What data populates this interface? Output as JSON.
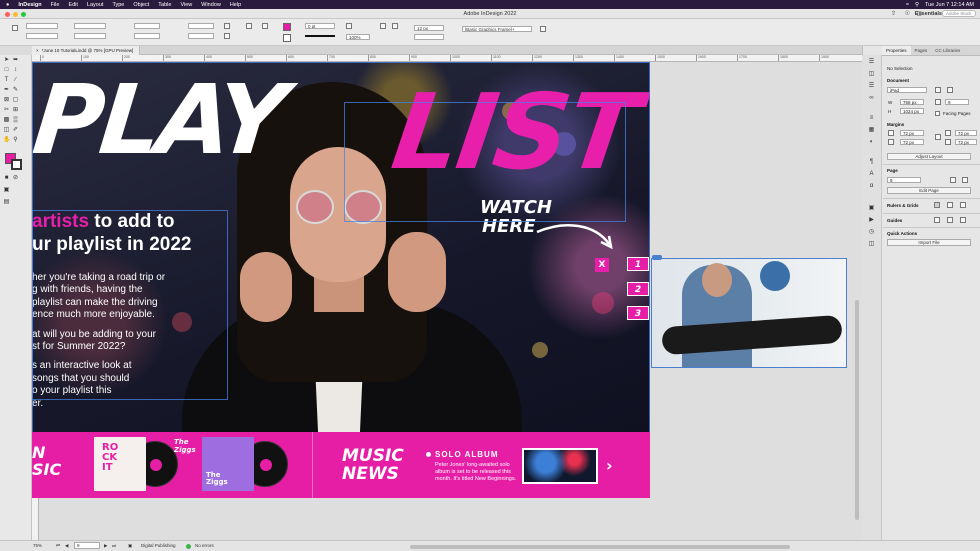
{
  "os_menubar": {
    "app_name": "InDesign",
    "menus": [
      "File",
      "Edit",
      "Layout",
      "Type",
      "Object",
      "Table",
      "View",
      "Window",
      "Help"
    ],
    "clock": "Tue Jun 7  12:14 AM"
  },
  "window": {
    "title": "Adobe InDesign 2022",
    "workspace": "Essentials",
    "search_placeholder": "Adobe Stock"
  },
  "control_bar": {
    "stroke_weight": "0 pt",
    "percent_value": "100%",
    "font_size_value": "12 px",
    "frame_style": "[Basic Graphics Frame]+"
  },
  "document_tab": {
    "label": "*June 10 TutorialLindd @ 75% [GPU Preview]"
  },
  "ruler_ticks": [
    "0",
    "100",
    "200",
    "300",
    "400",
    "500",
    "600",
    "700",
    "800",
    "900",
    "1000",
    "1100",
    "1200",
    "1300",
    "1400",
    "1500",
    "1600",
    "1700",
    "1800",
    "1900"
  ],
  "artwork": {
    "headline_left": "PLAY",
    "headline_right": "LIST",
    "subhead_pink": "artists",
    "subhead_rest_1": " to add to",
    "subhead_line2": "ur playlist in 2022",
    "body_lines": [
      [
        "her you're taking a road trip or",
        "g with friends, having the",
        "playlist can make the driving",
        "ence much more enjoyable."
      ],
      [
        "at will you be adding to your",
        "st for Summer 2022?"
      ],
      [
        "s an interactive look at",
        "songs that you should",
        "o your playlist this",
        "er."
      ]
    ],
    "watch_here": [
      "WATCH",
      "HERE"
    ],
    "close_button": "X",
    "band_left": [
      "N",
      "SIC"
    ],
    "album1_text": [
      "RO",
      "CK",
      "IT"
    ],
    "album2_text": [
      "The",
      "Ziggs"
    ],
    "band_small": [
      "The",
      "Ziggs"
    ],
    "music_news": [
      "MUSIC",
      "NEWS"
    ],
    "solo_title": "SOLO ALBUM",
    "solo_desc": "Peter Jones' long-awaited solo album is set to be released this month. It's titled New Beginnings.",
    "next_chevron": "›"
  },
  "pasteboard_buttons": [
    "1",
    "2",
    "3"
  ],
  "properties_panel": {
    "tabs": [
      "Properties",
      "Pages",
      "CC Libraries"
    ],
    "selection": "No Selection",
    "document_heading": "Document",
    "preset": "iPad",
    "width": "768 px",
    "height": "1024 px",
    "pages_count": "9",
    "facing_pages_label": "Facing Pages",
    "margins_heading": "Margins",
    "margin_values": [
      "72 px",
      "72 px",
      "72 px",
      "72 px"
    ],
    "adjust_layout": "Adjust Layout",
    "page_heading": "Page",
    "page_value": "9",
    "edit_page": "Edit Page",
    "rulers_heading": "Rulers & Grids",
    "guides_heading": "Guides",
    "quick_actions_heading": "Quick Actions",
    "import_file": "Import File"
  },
  "status_bar": {
    "zoom": "75%",
    "page_number": "9",
    "preflight_profile": "Digital Publishing",
    "errors": "No errors"
  },
  "colors": {
    "brand_pink": "#e61ea6",
    "menubar": "#2a1a3e"
  }
}
